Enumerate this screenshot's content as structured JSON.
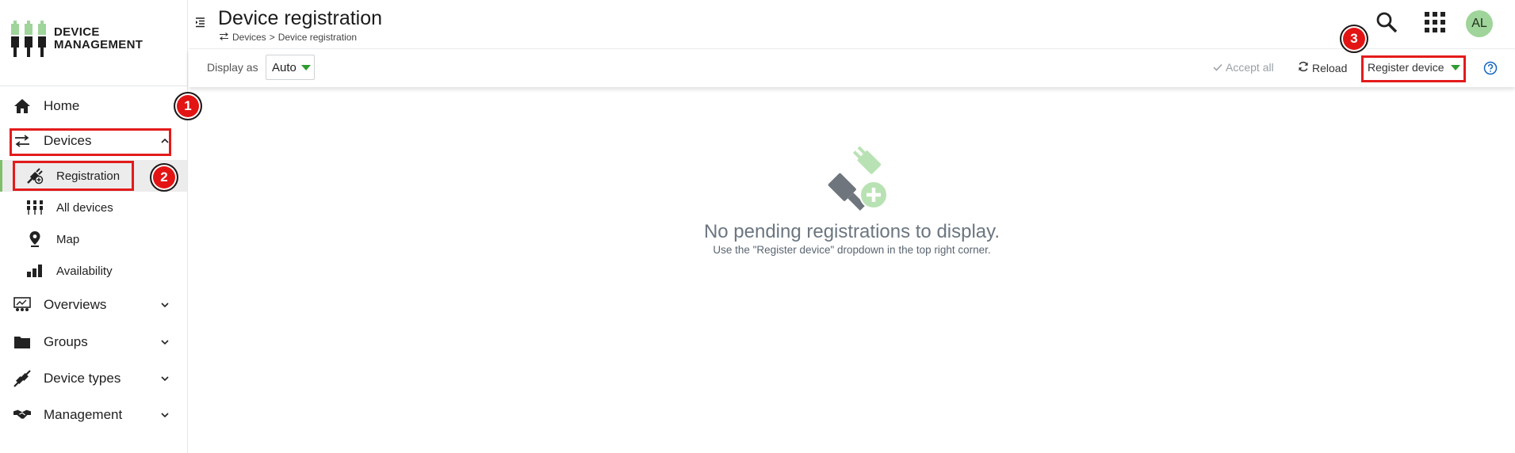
{
  "app": {
    "logo_line1": "DEVICE",
    "logo_line2": "MANAGEMENT",
    "brand_color": "#7fbf6a"
  },
  "sidebar": {
    "home": "Home",
    "devices": "Devices",
    "devices_sub": [
      "Registration",
      "All devices",
      "Map",
      "Availability"
    ],
    "overviews": "Overviews",
    "groups": "Groups",
    "device_types": "Device types",
    "management": "Management"
  },
  "header": {
    "title": "Device registration",
    "breadcrumb": [
      "Devices",
      ">",
      "Device registration"
    ],
    "avatar_initials": "AL",
    "icons": [
      "search-icon",
      "apps-grid-icon"
    ]
  },
  "toolbar": {
    "display_as_label": "Display as",
    "display_as_value": "Auto",
    "accept_all": "Accept all",
    "reload": "Reload",
    "register_device": "Register device"
  },
  "empty_state": {
    "title": "No pending registrations to display.",
    "subtitle": "Use the \"Register device\" dropdown in the top right corner."
  },
  "annotations": [
    "1",
    "2",
    "3"
  ]
}
